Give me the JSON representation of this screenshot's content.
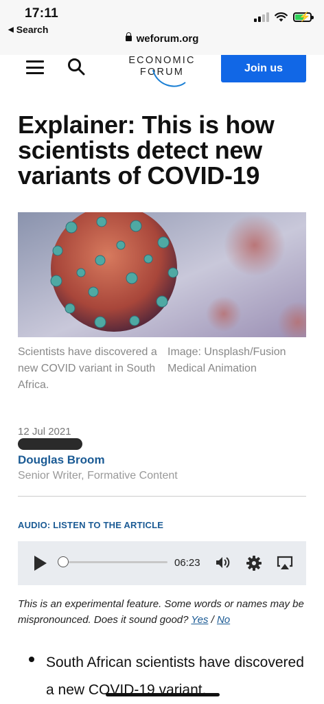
{
  "status_bar": {
    "time": "17:11",
    "back_label": "Search",
    "url": "weforum.org",
    "signal_icon": "cellular-signal-icon",
    "wifi_icon": "wifi-icon",
    "battery_icon": "battery-charging-icon"
  },
  "header": {
    "menu_icon": "hamburger-menu-icon",
    "search_icon": "search-icon",
    "logo_line1": "ECONOMIC",
    "logo_line2": "FORUM",
    "join_label": "Join us",
    "accent_color": "#1167e6"
  },
  "article": {
    "headline": "Explainer: This is how scientists detect new variants of COVID-19",
    "image_caption": "Scientists have discovered a new COVID variant in South Africa.",
    "image_credit": "Image: Unsplash/Fusion Medical Animation",
    "date": "12 Jul 2021",
    "author_name": "Douglas Broom",
    "author_role": "Senior Writer, Formative Content"
  },
  "audio": {
    "label": "AUDIO: LISTEN TO THE ARTICLE",
    "duration": "06:23",
    "progress": 0,
    "note_prefix": "This is an experimental feature. Some words or names may be mispronounced. Does it sound good?",
    "yes_label": "Yes",
    "separator": "/",
    "no_label": "No"
  },
  "body": {
    "bullets": [
      "South African scientists have discovered a new COVID-19 variant."
    ]
  }
}
